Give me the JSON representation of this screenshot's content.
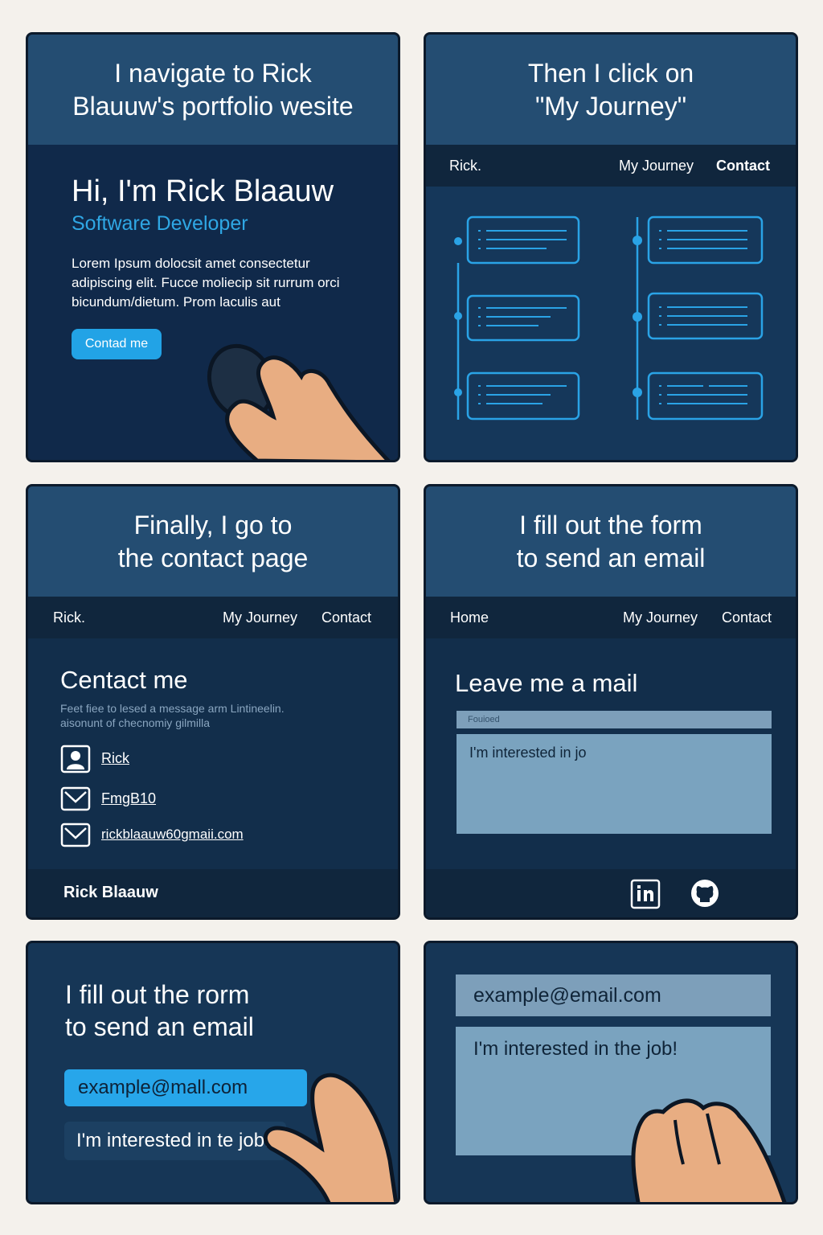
{
  "panels": {
    "p1": {
      "caption_line1": "I navigate to Rick",
      "caption_line2": "Blauuw's portfolio wesite",
      "hero_title": "Hi, I'm Rick Blaauw",
      "hero_subtitle": "Software Developer",
      "hero_text": "Lorem Ipsum dolocsit amet consectetur adipiscing elit. Fucce moliecip sit rurrum orci bicundum/dietum. Prom laculis aut",
      "button_label": "Contad me"
    },
    "p2": {
      "caption_line1": "Then I click on",
      "caption_line2": "\"My Journey\"",
      "nav_brand": "Rick.",
      "nav_journey": "My Journey",
      "nav_contact": "Contact"
    },
    "p3": {
      "caption_line1": "Finally, I go to",
      "caption_line2": "the contact page",
      "nav_brand": "Rick.",
      "nav_journey": "My Journey",
      "nav_contact": "Contact",
      "title": "Centact me",
      "note": "Feet fiee to lesed a message arm Lintineelin. aisonunt of checnomiy gilmilla",
      "contacts": [
        {
          "label": "Rick",
          "icon": "person-icon"
        },
        {
          "label": "FmgB10",
          "icon": "mail-icon"
        },
        {
          "label": "rickblaauw60gmaii.com",
          "icon": "mail-icon"
        }
      ],
      "footer_name": "Rick Blaauw"
    },
    "p4": {
      "caption_line1": "I fill out the form",
      "caption_line2": "to send an email",
      "nav_home": "Home",
      "nav_journey": "My Journey",
      "nav_contact": "Contact",
      "title": "Leave me a mail",
      "field_label": "Fouioed",
      "message_value": "I'm interested in jo"
    },
    "p5": {
      "caption_line1": "I fill out the rorm",
      "caption_line2": "to send an email",
      "email_value": "example@mall.com",
      "message_value": "I'm interested in te job!"
    },
    "p6": {
      "email_value": "example@email.com",
      "message_value": "I'm interested in the job!"
    }
  },
  "colors": {
    "accent": "#2fa7e4",
    "caption_bg": "#244d72",
    "nav_bg": "#10263d",
    "panel_bg": "#14324f",
    "skin": "#e8ad82"
  }
}
